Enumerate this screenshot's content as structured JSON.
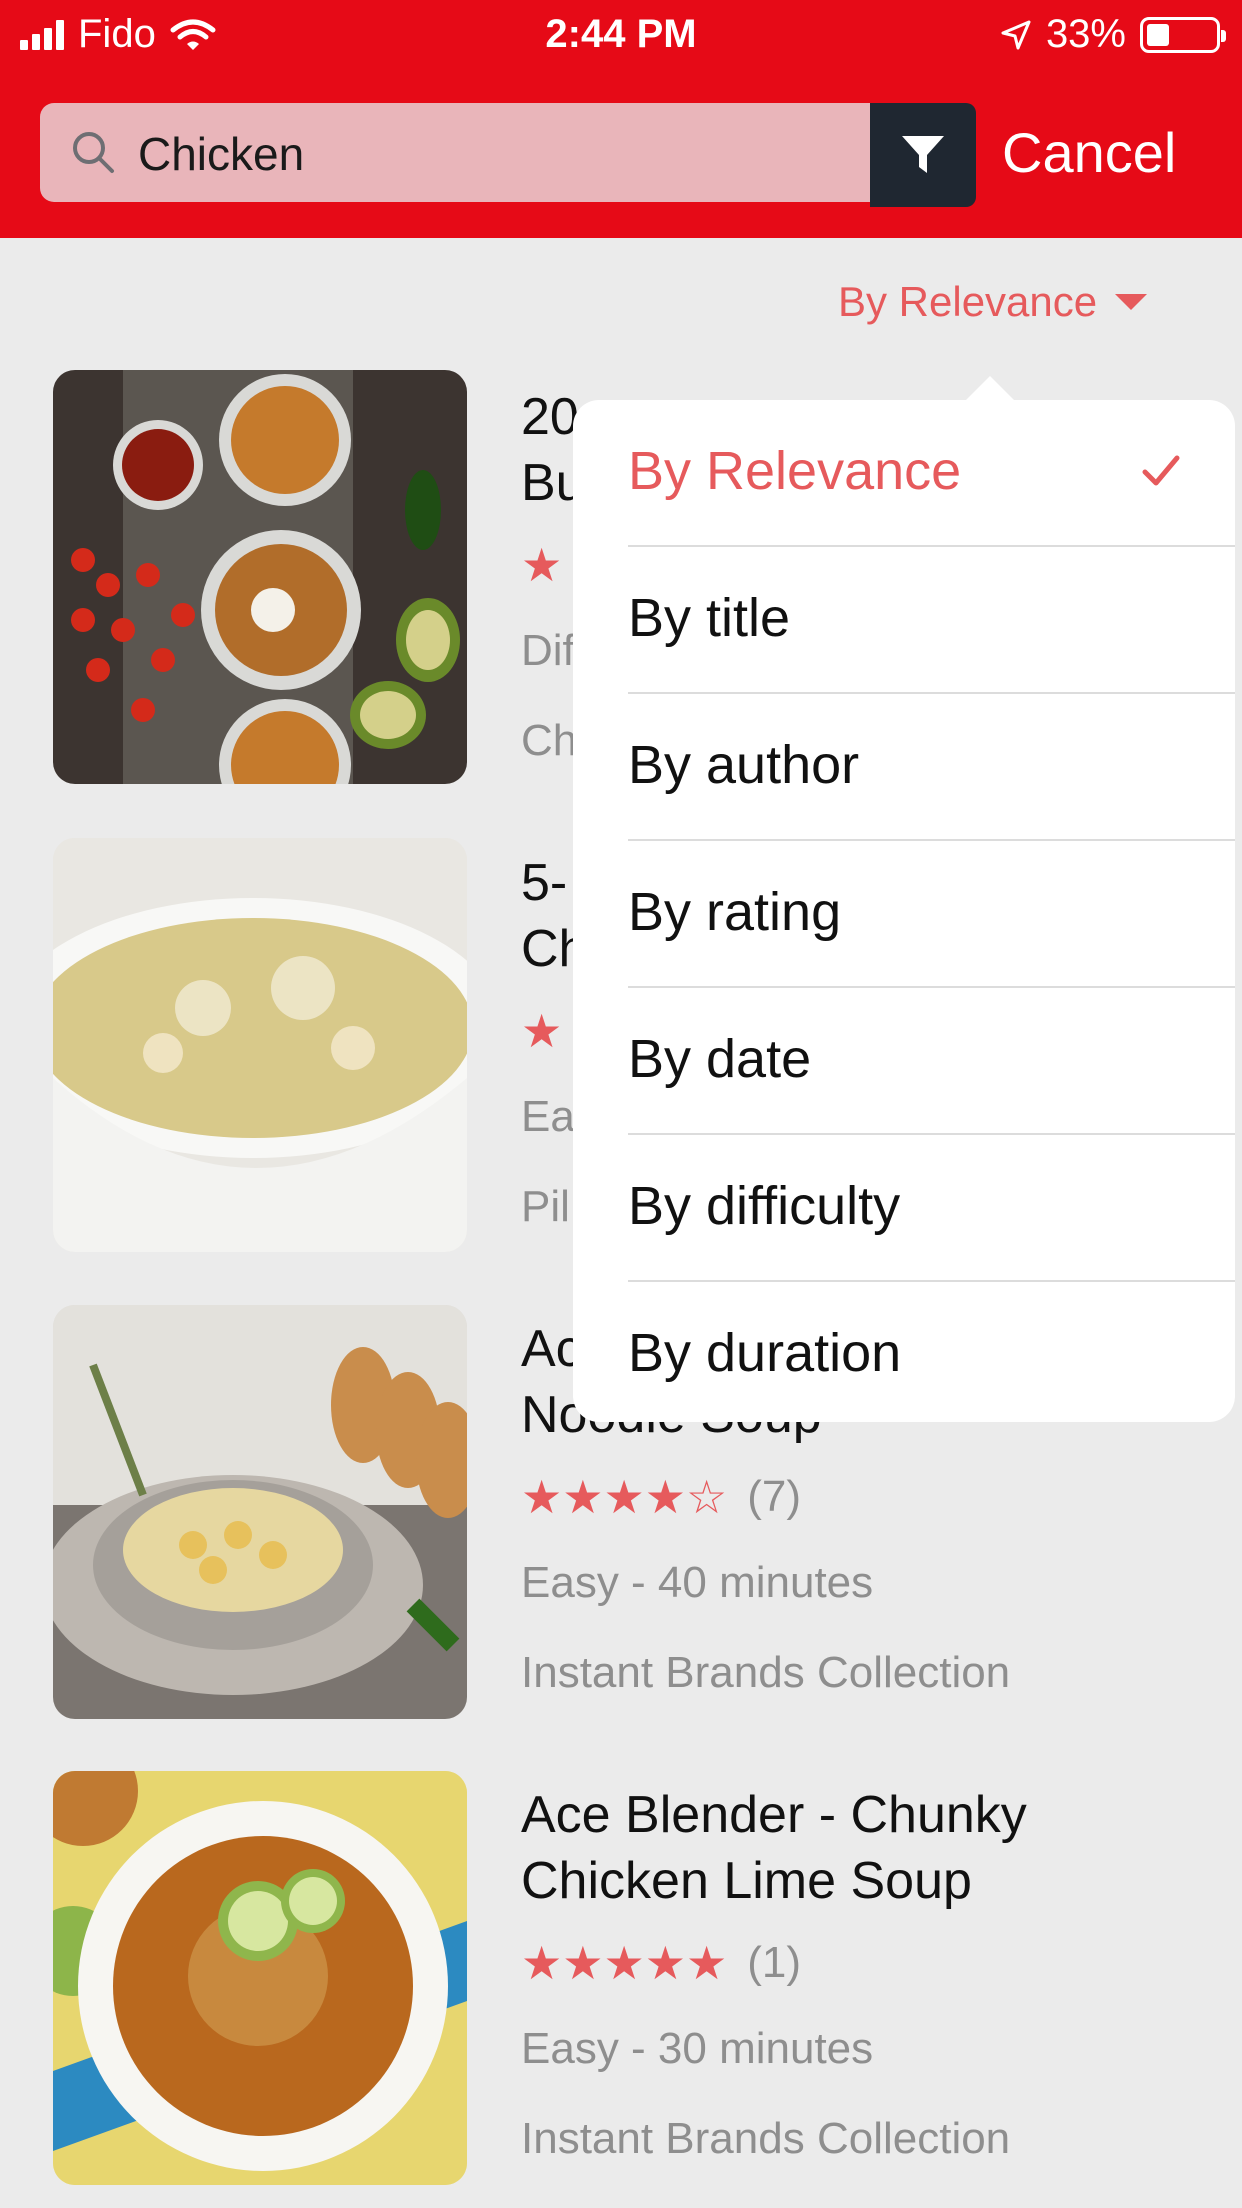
{
  "status_bar": {
    "carrier": "Fido",
    "time": "2:44 PM",
    "battery": "33%"
  },
  "search": {
    "query": "Chicken",
    "cancel_label": "Cancel"
  },
  "sort": {
    "current_label": "By Relevance"
  },
  "dropdown": {
    "options": [
      {
        "label": "By Relevance",
        "selected": true
      },
      {
        "label": "By title",
        "selected": false
      },
      {
        "label": "By author",
        "selected": false
      },
      {
        "label": "By rating",
        "selected": false
      },
      {
        "label": "By date",
        "selected": false
      },
      {
        "label": "By difficulty",
        "selected": false
      },
      {
        "label": "By duration",
        "selected": false
      }
    ]
  },
  "recipes": [
    {
      "title_line1": "20",
      "title_line2": "Bu",
      "rating_visible": "★",
      "meta": "Dif",
      "collection": "Ch"
    },
    {
      "title_line1": "5-",
      "title_line2": "Ch",
      "rating_visible": "★",
      "meta": "Ea",
      "collection": "Pil"
    },
    {
      "title_line1": "Ac",
      "title_line2": "Noodle Soup",
      "stars": "★★★★☆",
      "rating_count": "(7)",
      "meta": "Easy - 40 minutes",
      "collection": "Instant Brands Collection"
    },
    {
      "title_line1": "Ace Blender - Chunky",
      "title_line2": "Chicken Lime Soup",
      "stars": "★★★★★",
      "rating_count": "(1)",
      "meta": "Easy - 30 minutes",
      "collection": "Instant Brands Collection"
    }
  ],
  "colors": {
    "brand_red": "#e60a17",
    "accent": "#e65a5c",
    "filter_bg": "#1f2731"
  }
}
